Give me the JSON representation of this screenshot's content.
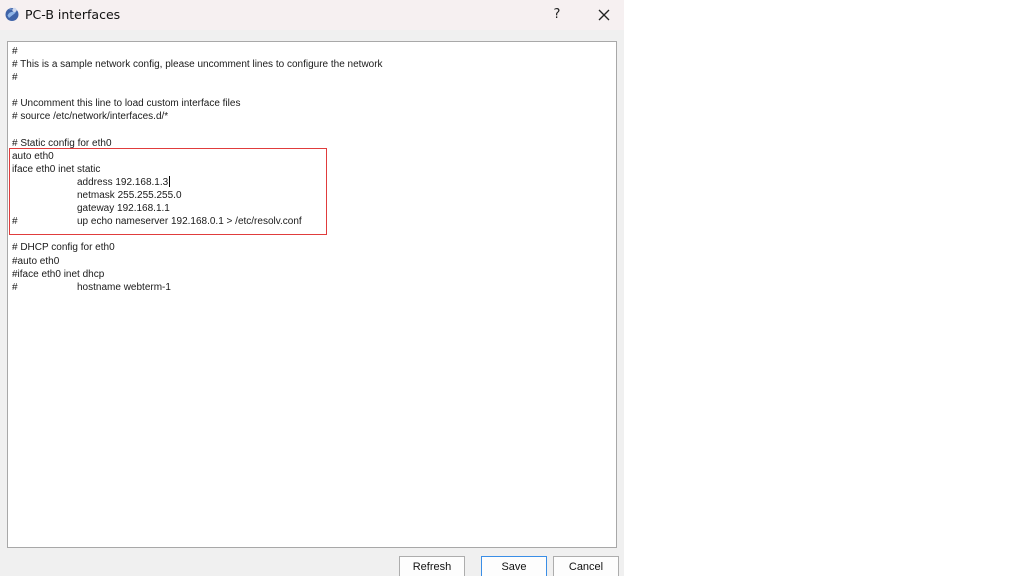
{
  "window": {
    "title": "PC-B interfaces",
    "help_label": "?",
    "close_icon": "close-icon",
    "app_icon": "app-logo-icon"
  },
  "editor": {
    "lines": [
      "#",
      "# This is a sample network config, please uncomment lines to configure the network",
      "#",
      "",
      "# Uncomment this line to load custom interface files",
      "# source /etc/network/interfaces.d/*",
      "",
      "# Static config for eth0",
      "auto eth0",
      "iface eth0 inet static",
      "\taddress 192.168.1.3",
      "\tnetmask 255.255.255.0",
      "\tgateway 192.168.1.1",
      "#\tup echo nameserver 192.168.0.1 > /etc/resolv.conf",
      "",
      "# DHCP config for eth0",
      "#auto eth0",
      "#iface eth0 inet dhcp",
      "#\thostname webterm-1"
    ],
    "caret_line": 10
  },
  "buttons": {
    "refresh": "Refresh",
    "save": "Save",
    "cancel": "Cancel"
  },
  "colors": {
    "highlight": "#e03c3c",
    "save_border": "#3a8ee6"
  }
}
